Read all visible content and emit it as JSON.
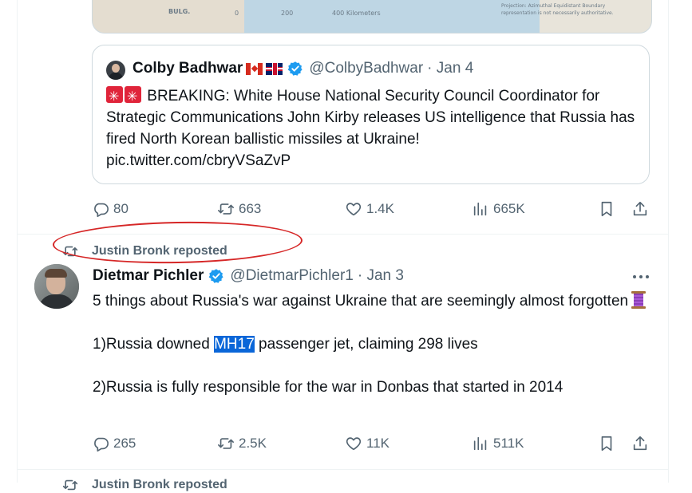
{
  "map_image": {
    "labels": [
      "BULG.",
      "0",
      "200",
      "400 Kilometers"
    ],
    "caption": "Projection: Azimuthal Equidistant Boundary representation is not necessarily authoritative."
  },
  "quoted_tweet": {
    "name": "Colby Badhwar",
    "handle": "@ColbyBadhwar",
    "date": "· Jan 4",
    "text": "BREAKING: White House National Security Council Coordinator for Strategic Communications John Kirby releases US intelligence that Russia has fired North Korean ballistic missiles at Ukraine!",
    "link": "pic.twitter.com/cbryVSaZvP"
  },
  "first_actions": {
    "replies": "80",
    "reposts": "663",
    "likes": "1.4K",
    "views": "665K"
  },
  "repost_label": "Justin Bronk reposted",
  "tweet": {
    "name": "Dietmar Pichler",
    "handle": "@DietmarPichler1",
    "date": "· Jan 3",
    "line1": "5 things about Russia's war against Ukraine that are seemingly almost forgotten",
    "line2_before": "1)Russia downed ",
    "line2_highlight": "MH17",
    "line2_after": " passenger jet, claiming 298 lives",
    "line3": "2)Russia is fully responsible for the war in Donbas that started in 2014"
  },
  "second_actions": {
    "replies": "265",
    "reposts": "2.5K",
    "likes": "11K",
    "views": "511K"
  },
  "next_repost_label": "Justin Bronk reposted",
  "colors": {
    "verified": "#1d9bf0",
    "annotation": "#d62727",
    "selection": "#0a66d8"
  },
  "icons": [
    "reply-icon",
    "repost-icon",
    "like-icon",
    "views-icon",
    "bookmark-icon",
    "share-icon",
    "more-icon",
    "verified-icon"
  ]
}
